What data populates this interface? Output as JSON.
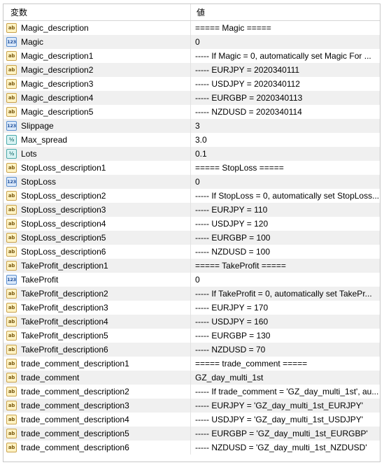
{
  "header": {
    "col_variable": "変数",
    "col_value": "値"
  },
  "icon_types": {
    "ab": "ab",
    "n123": "123",
    "frac": "½"
  },
  "rows": [
    {
      "type": "ab",
      "name": "Magic_description",
      "value": "===== Magic ====="
    },
    {
      "type": "n123",
      "name": "Magic",
      "value": "0"
    },
    {
      "type": "ab",
      "name": "Magic_description1",
      "value": "----- If Magic = 0, automatically set Magic For ..."
    },
    {
      "type": "ab",
      "name": "Magic_description2",
      "value": "----- EURJPY = 2020340111"
    },
    {
      "type": "ab",
      "name": "Magic_description3",
      "value": "----- USDJPY = 2020340112"
    },
    {
      "type": "ab",
      "name": "Magic_description4",
      "value": "----- EURGBP = 2020340113"
    },
    {
      "type": "ab",
      "name": "Magic_description5",
      "value": "----- NZDUSD = 2020340114"
    },
    {
      "type": "n123",
      "name": "Slippage",
      "value": "3"
    },
    {
      "type": "frac",
      "name": "Max_spread",
      "value": "3.0"
    },
    {
      "type": "frac",
      "name": "Lots",
      "value": "0.1"
    },
    {
      "type": "ab",
      "name": "StopLoss_description1",
      "value": "===== StopLoss ====="
    },
    {
      "type": "n123",
      "name": "StopLoss",
      "value": "0"
    },
    {
      "type": "ab",
      "name": "StopLoss_description2",
      "value": "----- If StopLoss = 0, automatically set StopLoss..."
    },
    {
      "type": "ab",
      "name": "StopLoss_description3",
      "value": "----- EURJPY = 110"
    },
    {
      "type": "ab",
      "name": "StopLoss_description4",
      "value": "----- USDJPY = 120"
    },
    {
      "type": "ab",
      "name": "StopLoss_description5",
      "value": "----- EURGBP = 100"
    },
    {
      "type": "ab",
      "name": "StopLoss_description6",
      "value": "----- NZDUSD = 100"
    },
    {
      "type": "ab",
      "name": "TakeProfit_description1",
      "value": "===== TakeProfit ====="
    },
    {
      "type": "n123",
      "name": "TakeProfit",
      "value": "0"
    },
    {
      "type": "ab",
      "name": "TakeProfit_description2",
      "value": "----- If TakeProfit = 0, automatically set TakePr..."
    },
    {
      "type": "ab",
      "name": "TakeProfit_description3",
      "value": "----- EURJPY = 170"
    },
    {
      "type": "ab",
      "name": "TakeProfit_description4",
      "value": "----- USDJPY = 160"
    },
    {
      "type": "ab",
      "name": "TakeProfit_description5",
      "value": "----- EURGBP = 130"
    },
    {
      "type": "ab",
      "name": "TakeProfit_description6",
      "value": "----- NZDUSD = 70"
    },
    {
      "type": "ab",
      "name": "trade_comment_description1",
      "value": "===== trade_comment ====="
    },
    {
      "type": "ab",
      "name": "trade_comment",
      "value": "GZ_day_multi_1st"
    },
    {
      "type": "ab",
      "name": "trade_comment_description2",
      "value": "----- If trade_comment = 'GZ_day_multi_1st', au..."
    },
    {
      "type": "ab",
      "name": "trade_comment_description3",
      "value": "----- EURJPY = 'GZ_day_multi_1st_EURJPY'"
    },
    {
      "type": "ab",
      "name": "trade_comment_description4",
      "value": "----- USDJPY = 'GZ_day_multi_1st_USDJPY'"
    },
    {
      "type": "ab",
      "name": "trade_comment_description5",
      "value": "----- EURGBP = 'GZ_day_multi_1st_EURGBP'"
    },
    {
      "type": "ab",
      "name": "trade_comment_description6",
      "value": "----- NZDUSD = 'GZ_day_multi_1st_NZDUSD'"
    }
  ]
}
